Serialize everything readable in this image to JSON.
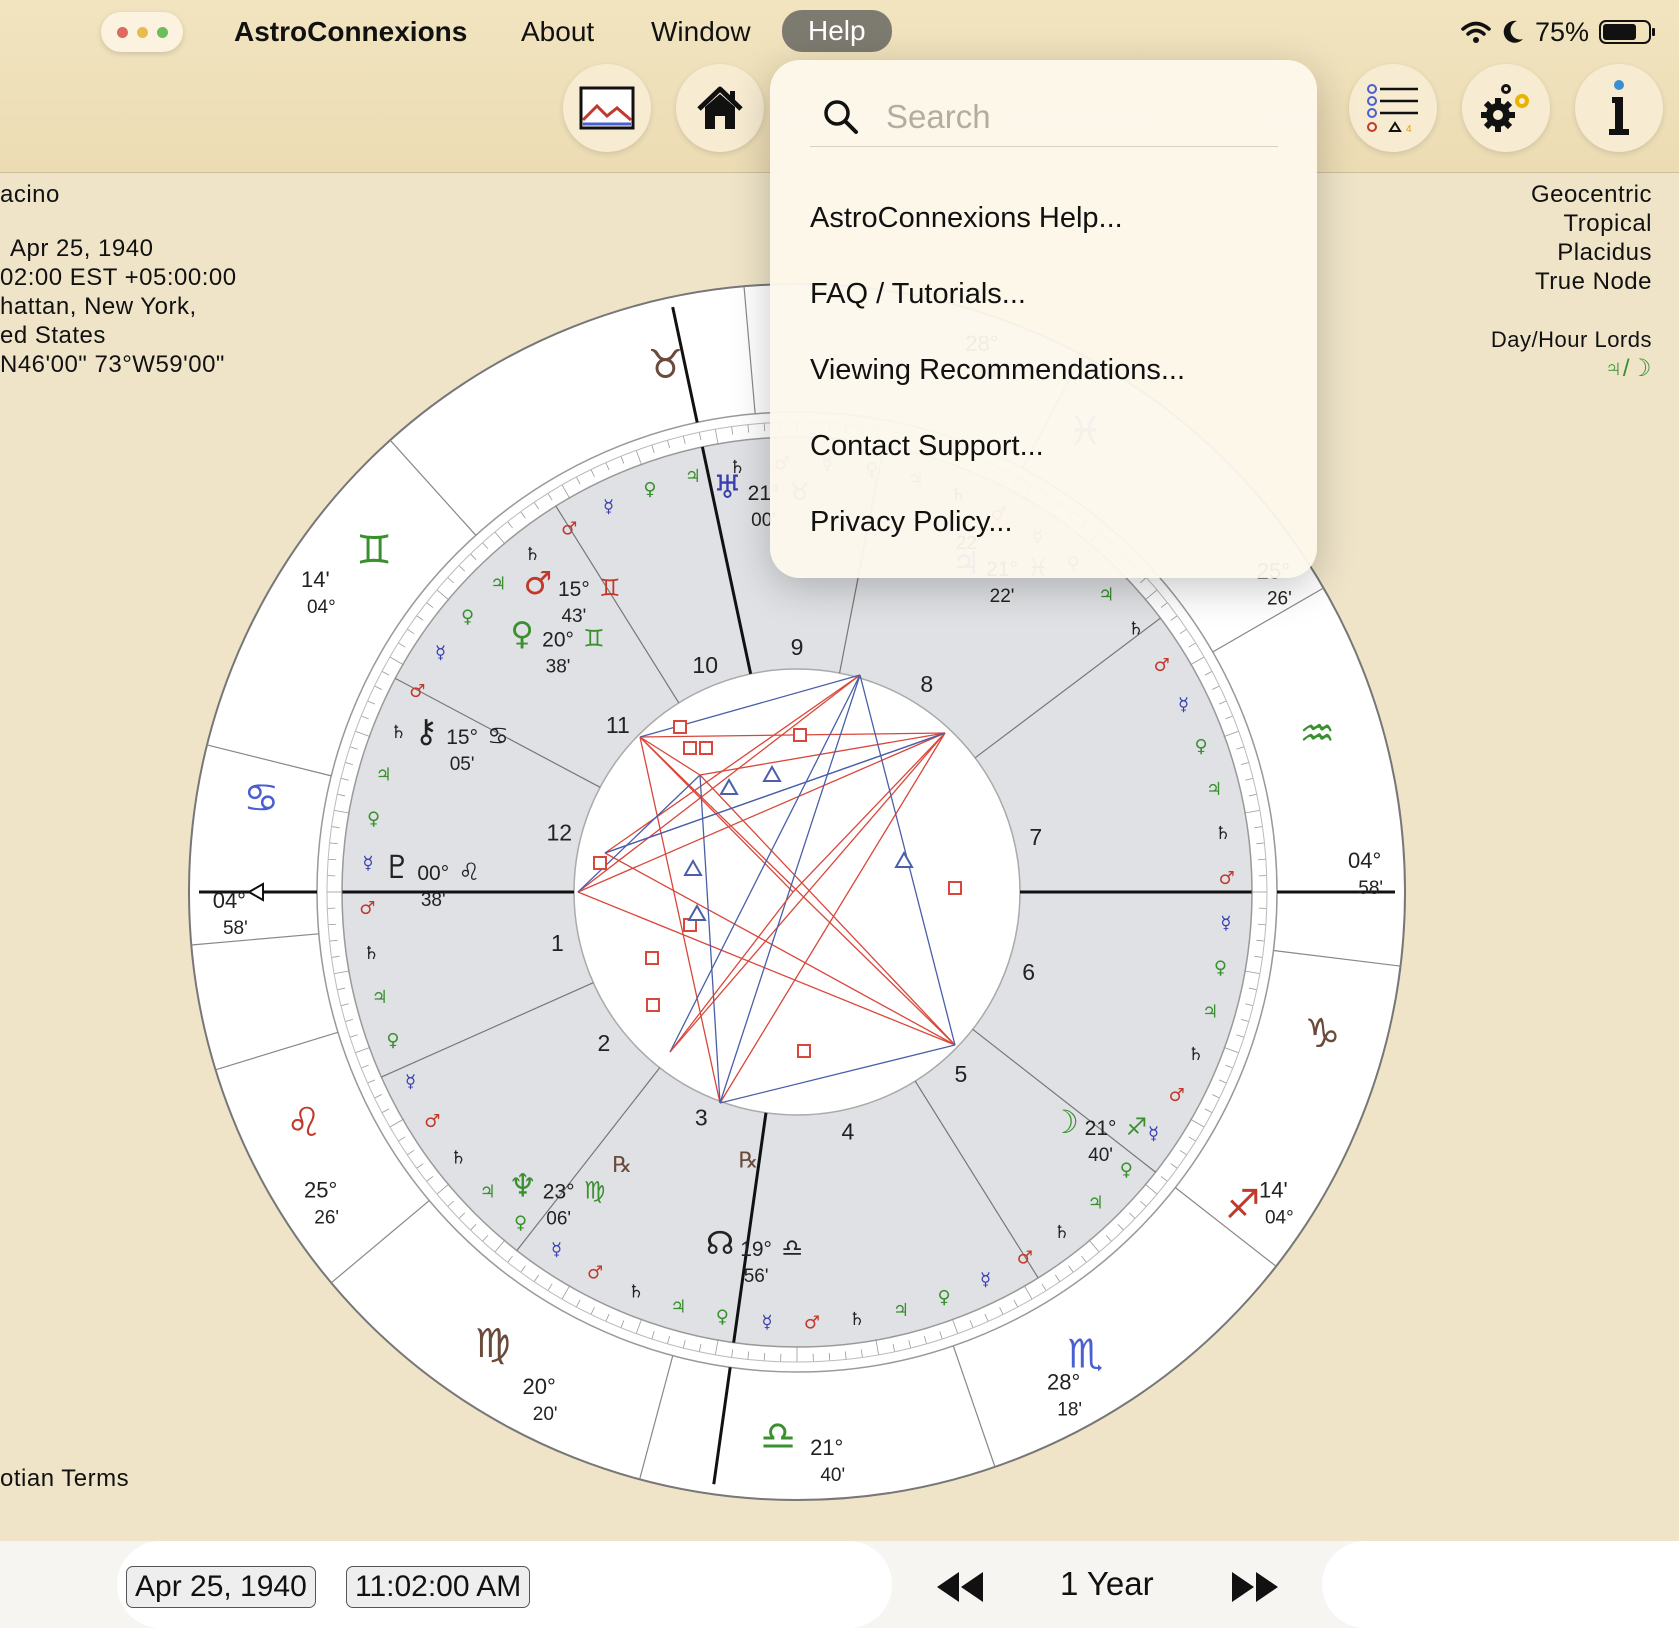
{
  "menubar": {
    "app_name": "AstroConnexions",
    "items": [
      "About",
      "Window",
      "Help"
    ],
    "active_item": "Help",
    "battery_percent_label": "75%",
    "battery_level": 0.75
  },
  "toolbar": {
    "buttons": [
      "image-icon",
      "home-icon",
      "checklist-icon",
      "gear-icon",
      "info-icon"
    ]
  },
  "chart_info": {
    "left_lines": [
      "acino",
      "",
      "Apr 25, 1940",
      "02:00 EST +05:00:00",
      "hattan, New York,",
      "ed States",
      "N46'00\" 73°W59'00\""
    ],
    "right_lines": [
      "Geocentric",
      "Tropical",
      "Placidus",
      "True Node"
    ],
    "lords_label": "Day/Hour Lords",
    "lords_value": "♃/☽",
    "terms_label": "otian Terms"
  },
  "wheel": {
    "house_numbers": [
      "1",
      "2",
      "3",
      "4",
      "5",
      "6",
      "7",
      "8",
      "9",
      "10",
      "11",
      "12"
    ],
    "cusp_labels": [
      {
        "deg": "04°",
        "min": "58'"
      },
      {
        "deg": "25°",
        "min": "26'"
      },
      {
        "deg": "20°",
        "min": "20'"
      },
      {
        "deg": "21°",
        "min": "40'"
      },
      {
        "deg": "28°",
        "min": "18'"
      },
      {
        "deg": "14'",
        "min": "04°"
      },
      {
        "deg": "04°",
        "min": "58'"
      },
      {
        "deg": "25°",
        "min": "26'"
      },
      {
        "deg": "28°",
        "min": "18'"
      },
      {
        "deg": "14'",
        "min": "04°"
      }
    ],
    "planet_labels": [
      {
        "glyph": "♅",
        "deg": "21°",
        "sign": "♉",
        "min": "00'"
      },
      {
        "glyph": "♂",
        "deg": "15°",
        "sign": "♊",
        "min": "43'"
      },
      {
        "glyph": "♀",
        "deg": "20°",
        "sign": "♊",
        "min": "38'"
      },
      {
        "glyph": "⚷",
        "deg": "15°",
        "sign": "♋",
        "min": "05'"
      },
      {
        "glyph": "♇",
        "deg": "00°",
        "sign": "♌",
        "min": "38'"
      },
      {
        "glyph": "♆",
        "deg": "23°",
        "sign": "♍",
        "min": "06'"
      },
      {
        "glyph": "☊",
        "deg": "19°",
        "sign": "♎",
        "min": "56'"
      },
      {
        "glyph": "☽",
        "deg": "21°",
        "sign": "♐",
        "min": "40'"
      },
      {
        "glyph": "♃",
        "deg": "21°",
        "sign": "♓",
        "min": "22'"
      },
      {
        "glyph": "",
        "deg": "",
        "sign": "",
        "min": "22'"
      }
    ],
    "retro_glyph": "℞"
  },
  "help_menu": {
    "search_placeholder": "Search",
    "items": [
      "AstroConnexions Help...",
      "FAQ / Tutorials...",
      "Viewing Recommendations...",
      "Contact Support...",
      "Privacy Policy..."
    ]
  },
  "bottom": {
    "date": "Apr 25, 1940",
    "time": "11:02:00 AM",
    "period": "1 Year"
  },
  "colors": {
    "background": "#efe4c8",
    "aspect_red": "#d9473a",
    "aspect_blue": "#4a5fa8",
    "fire": "#c0392b",
    "earth": "#6b4a3a",
    "air": "#3a8f2f",
    "water": "#4a5fd0"
  }
}
